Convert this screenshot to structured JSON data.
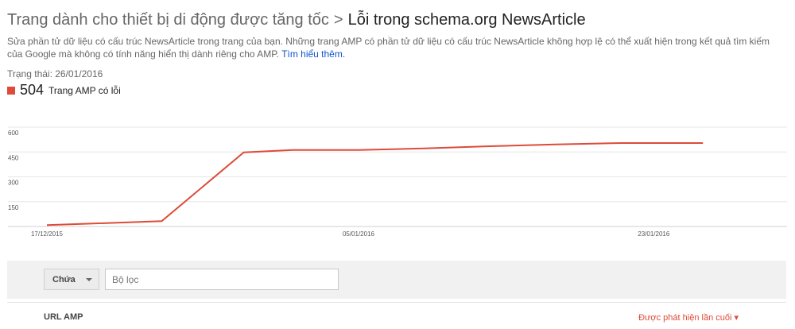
{
  "breadcrumb": {
    "parent": "Trang dành cho thiết bị di động được tăng tốc",
    "separator": ">",
    "current": "Lỗi trong schema.org NewsArticle"
  },
  "description": {
    "text": "Sửa phần tử dữ liệu có cấu trúc NewsArticle trong trang của bạn. Những trang AMP có phần tử dữ liệu có cấu trúc NewsArticle không hợp lệ có thể xuất hiện trong kết quả tìm kiếm của Google mà không có tính năng hiển thị dành riêng cho AMP.",
    "link": "Tìm hiểu thêm."
  },
  "status": "Trạng thái: 26/01/2016",
  "legend": {
    "count": "504",
    "label": "Trang AMP có lỗi",
    "color": "#dd4b39"
  },
  "chart_data": {
    "type": "line",
    "x": [
      "2015-12-17",
      "2015-12-24",
      "2015-12-29",
      "2016-01-01",
      "2016-01-05",
      "2016-01-09",
      "2016-01-13",
      "2016-01-17",
      "2016-01-21",
      "2016-01-26"
    ],
    "series": [
      {
        "values": [
          8,
          32,
          448,
          462,
          462,
          472,
          485,
          496,
          504,
          504
        ]
      }
    ],
    "ylim": [
      0,
      600
    ],
    "yticks": [
      "600",
      "450",
      "300",
      "150"
    ],
    "xticks": [
      "17/12/2015",
      "05/01/2016",
      "23/01/2016"
    ],
    "grid": true,
    "color": "#dd4b39"
  },
  "filter": {
    "dropdown": "Chứa",
    "placeholder": "Bộ lọc"
  },
  "table": {
    "col_url": "URL AMP",
    "col_detected": "Được phát hiện lần cuối ▾"
  }
}
